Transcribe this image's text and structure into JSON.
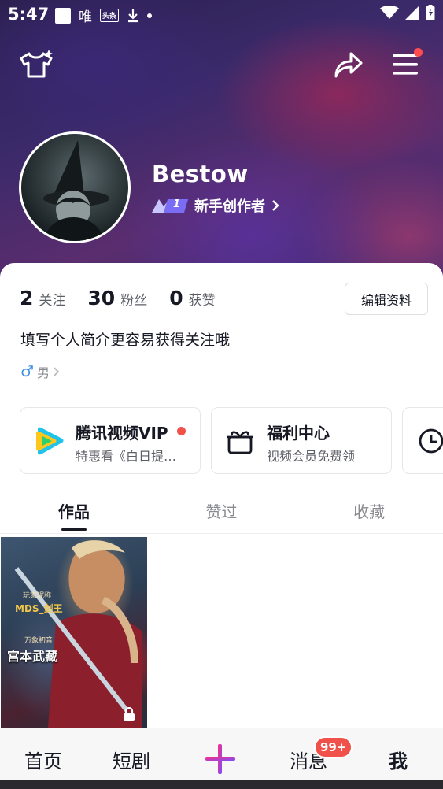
{
  "status_bar": {
    "time": "5:47",
    "carrier_text": "唯",
    "tag_text": "头条"
  },
  "header": {
    "username": "Bestow",
    "level": "1",
    "creator_label": "新手创作者"
  },
  "profile": {
    "stats": [
      {
        "value": "2",
        "label": "关注"
      },
      {
        "value": "30",
        "label": "粉丝"
      },
      {
        "value": "0",
        "label": "获赞"
      }
    ],
    "edit_label": "编辑资料",
    "bio": "填写个人简介更容易获得关注哦",
    "gender_symbol": "♂",
    "gender": "男"
  },
  "services": [
    {
      "title": "腾讯视频VIP",
      "subtitle": "特惠看《白日提…",
      "icon": "tencent-video-icon"
    },
    {
      "title": "福利中心",
      "subtitle": "视频会员免费领",
      "icon": "gift-icon"
    }
  ],
  "tabs": [
    {
      "label": "作品",
      "active": true
    },
    {
      "label": "赞过",
      "active": false
    },
    {
      "label": "收藏",
      "active": false
    }
  ],
  "works": [
    {
      "line1": "玩家昵称",
      "line2": "MDS_剑王",
      "line3": "万象初音",
      "line4": "宫本武藏",
      "locked": true
    }
  ],
  "bottom_nav": {
    "home": "首页",
    "drama": "短剧",
    "messages": "消息",
    "messages_badge": "99+",
    "me": "我"
  },
  "colors": {
    "accent_red": "#f0524b",
    "text_primary": "#161823",
    "text_secondary": "#5c5e66"
  }
}
